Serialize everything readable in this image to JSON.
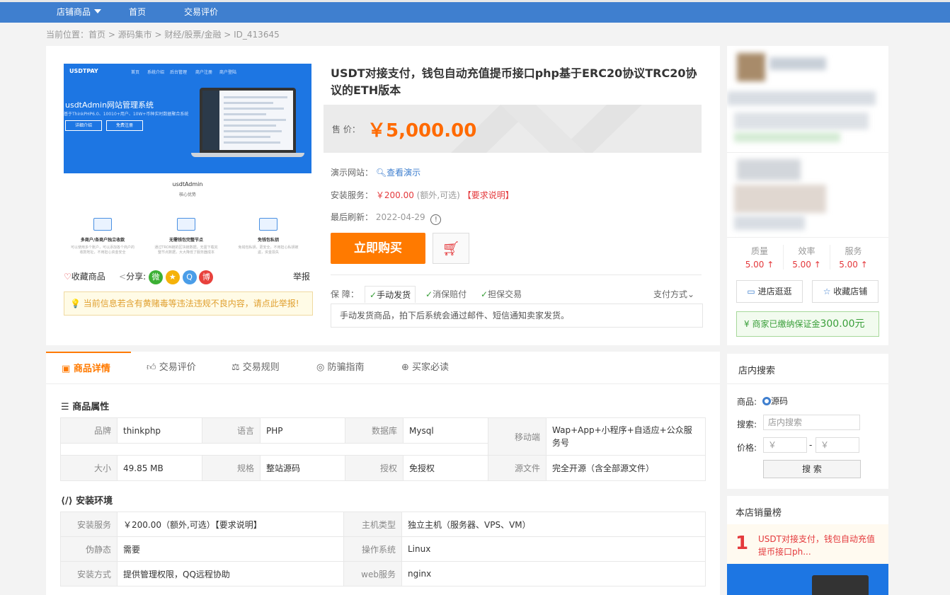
{
  "topnav": {
    "shop_goods": "店铺商品",
    "home": "首页",
    "reviews": "交易评价"
  },
  "breadcrumb": "当前位置：首页 > 源码集市 > 财经/股票/金融 > ID_413645",
  "screenshot": {
    "brand": "USDTPAY",
    "menu": [
      "首页",
      "系统介绍",
      "后台管理",
      "商户注册",
      "商户登陆"
    ],
    "hero_title": "usdtAdmin网站管理系统",
    "hero_sub": "基于ThinkPHP6.0、10010+用户、10W+币种实时数据聚合系统",
    "btn1": "详细介绍",
    "btn2": "免费注册",
    "mid_title": "usdtAdmin",
    "mid_sub": "核心优势",
    "features": [
      {
        "title": "多商户/各商户独立收款",
        "desc": "可以使用多个账户，可以添加各个商户的收款地址，不用担心资金安全"
      },
      {
        "title": "无需钱包完整节点",
        "desc": "通过TRON链的区块链数据，无需下载完整节点数据，大大降低了服务器成本"
      },
      {
        "title": "免钱包私钥",
        "desc": "免钱包私钥，更安全，不用担心私钥被盗，资金损失"
      }
    ]
  },
  "actions": {
    "favorite": "收藏商品",
    "share": "分享:",
    "report": "举报"
  },
  "warning": "当前信息若含有黄赌毒等违法违规不良内容，请点此举报!",
  "product": {
    "title": "USDT对接支付，钱包自动充值提币接口php基于ERC20协议TRC20协议的ETH版本",
    "price_label": "售 价：",
    "price": "￥5,000.00",
    "demo_label": "演示网站：",
    "demo_link": "查看演示",
    "install_label": "安装服务：",
    "install_price": "￥200.00",
    "install_note": "(额外,可选)",
    "install_req": "【要求说明】",
    "refresh_label": "最后刷新：",
    "refresh_date": "2022-04-29",
    "buy": "立即购买",
    "guarantee_label": "保 障：",
    "guarantees": [
      "手动发货",
      "消保赔付",
      "担保交易"
    ],
    "pay_method": "支付方式",
    "guarantee_desc": "手动发货商品，拍下后系统会通过邮件、短信通知卖家发货。"
  },
  "tabs": [
    "商品详情",
    "交易评价",
    "交易规则",
    "防骗指南",
    "买家必读"
  ],
  "attributes": {
    "title": "商品属性",
    "rows": [
      [
        [
          "品牌",
          "thinkphp"
        ],
        [
          "语言",
          "PHP"
        ],
        [
          "数据库",
          "Mysql"
        ],
        [
          "移动端",
          "Wap+App+小程序+自适应+公众服务号"
        ]
      ],
      [
        [
          "大小",
          "49.85 MB"
        ],
        [
          "规格",
          "整站源码"
        ],
        [
          "授权",
          "免授权"
        ],
        [
          "源文件",
          "完全开源（含全部源文件）"
        ]
      ]
    ]
  },
  "environment": {
    "title": "安装环境",
    "rows": [
      [
        [
          "安装服务",
          "￥200.00（额外,可选）【要求说明】"
        ],
        [
          "主机类型",
          "独立主机（服务器、VPS、VM）"
        ]
      ],
      [
        [
          "伪静态",
          "需要"
        ],
        [
          "操作系统",
          "Linux"
        ]
      ],
      [
        [
          "安装方式",
          "提供管理权限，QQ远程协助"
        ],
        [
          "web服务",
          "nginx"
        ]
      ]
    ]
  },
  "shop": {
    "scores": [
      {
        "label": "质量",
        "value": "5.00 ↑"
      },
      {
        "label": "效率",
        "value": "5.00 ↑"
      },
      {
        "label": "服务",
        "value": "5.00 ↑"
      }
    ],
    "visit": "进店逛逛",
    "collect": "收藏店铺",
    "deposit_text": "商家已缴纳保证金",
    "deposit_amount": "300.00元"
  },
  "search": {
    "title": "店内搜索",
    "goods_label": "商品:",
    "goods_option": "源码",
    "search_label": "搜索:",
    "search_placeholder": "店内搜索",
    "price_label": "价格:",
    "min": "￥",
    "max": "￥",
    "dash": "-",
    "button": "搜 索"
  },
  "ranking": {
    "title": "本店销量榜",
    "items": [
      {
        "rank": "1",
        "title": "USDT对接支付，钱包自动充值提币接口ph..."
      }
    ]
  },
  "colors": {
    "accent": "#ff7a00",
    "nav": "#3f7fcf",
    "price": "#ff6a00"
  }
}
